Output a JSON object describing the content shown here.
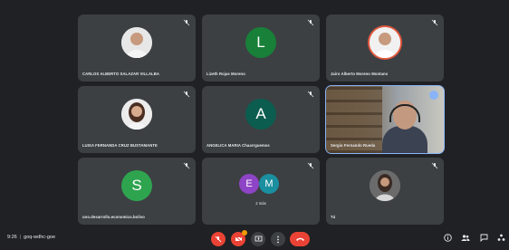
{
  "participants": [
    {
      "name": "CARLOS ALBERTO SALAZAR VILLALBA",
      "kind": "photo",
      "muted": true
    },
    {
      "name": "Lizeth Rojas Moreno",
      "kind": "letter",
      "letter": "L",
      "color": "#188038",
      "muted": true
    },
    {
      "name": "Jairo Alberto Moreno Montano",
      "kind": "photo",
      "muted": true
    },
    {
      "name": "LUISA FERNANDA CRUZ BUSTAMANTE",
      "kind": "photo",
      "muted": true
    },
    {
      "name": "ANGELICA MARIA Chaarrguemos",
      "kind": "letter",
      "letter": "A",
      "color": "#0b5d4f",
      "muted": true
    },
    {
      "name": "Sergio Fernando Rueda",
      "kind": "video",
      "speaking": true
    },
    {
      "name": "uno.desarrollo.economico.bolivo",
      "kind": "letter",
      "letter": "S",
      "color": "#2fa44f",
      "muted": true
    },
    {
      "name": "2 más",
      "kind": "group",
      "letters": [
        "E",
        "M"
      ],
      "muted": true
    },
    {
      "name": "Tú",
      "kind": "photo",
      "muted": true
    }
  ],
  "bottom_bar": {
    "time": "9:26",
    "meeting_code": "goq-wdhc-goe",
    "separator": "|"
  },
  "colors": {
    "background": "#202124",
    "tile": "#3c4043",
    "accent_red": "#ea4335",
    "speaking_outline": "#8ab4f8"
  },
  "icons": {
    "tile_status": "mic-off-icon",
    "speaking": "audio-level-icon",
    "controls": [
      "mic-off-icon",
      "camera-off-icon",
      "present-icon",
      "more-icon",
      "hang-up-icon"
    ],
    "right": [
      "info-icon",
      "people-icon",
      "chat-icon",
      "activities-icon"
    ]
  }
}
